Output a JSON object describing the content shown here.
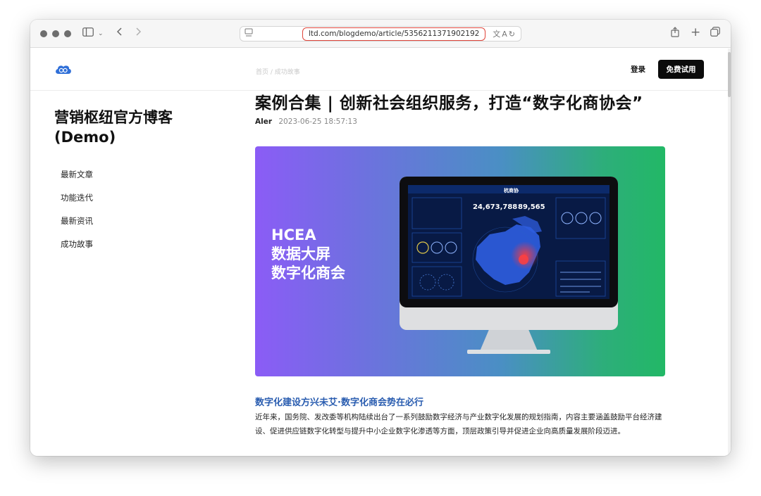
{
  "browser": {
    "url": "ltd.com/blogdemo/article/5356211371902192"
  },
  "header": {
    "breadcrumb": "首页 / 成功故事",
    "login_label": "登录",
    "trial_label": "免费试用"
  },
  "sidebar": {
    "blog_title": "营销枢纽官方博客(Demo)",
    "items": [
      {
        "label": "最新文章"
      },
      {
        "label": "功能迭代"
      },
      {
        "label": "最新资讯"
      },
      {
        "label": "成功故事"
      }
    ]
  },
  "article": {
    "title": "案例合集 | 创新社会组织服务，打造“数字化商协会”",
    "author": "Aler",
    "date": "2023-06-25 18:57:13",
    "hero": {
      "line1": "HCEA",
      "line2": "数据大屏",
      "line3": "数字化商会",
      "screen_brand": "杭商协",
      "stat1": "24,673,788",
      "stat2": "89,565"
    },
    "section_heading": "数字化建设方兴未艾·数字化商会势在必行",
    "paragraph": "近年来，国务院、发改委等机构陆续出台了一系列鼓励数字经济与产业数字化发展的规划指南，内容主要涵盖鼓励平台经济建设、促进供应链数字化转型与提升中小企业数字化渗透等方面，顶层政策引导并促进企业向高质量发展阶段迈进。"
  },
  "colors": {
    "heading_blue": "#2a5db0",
    "url_highlight": "#e0453a",
    "button_black": "#0b0b0b"
  }
}
